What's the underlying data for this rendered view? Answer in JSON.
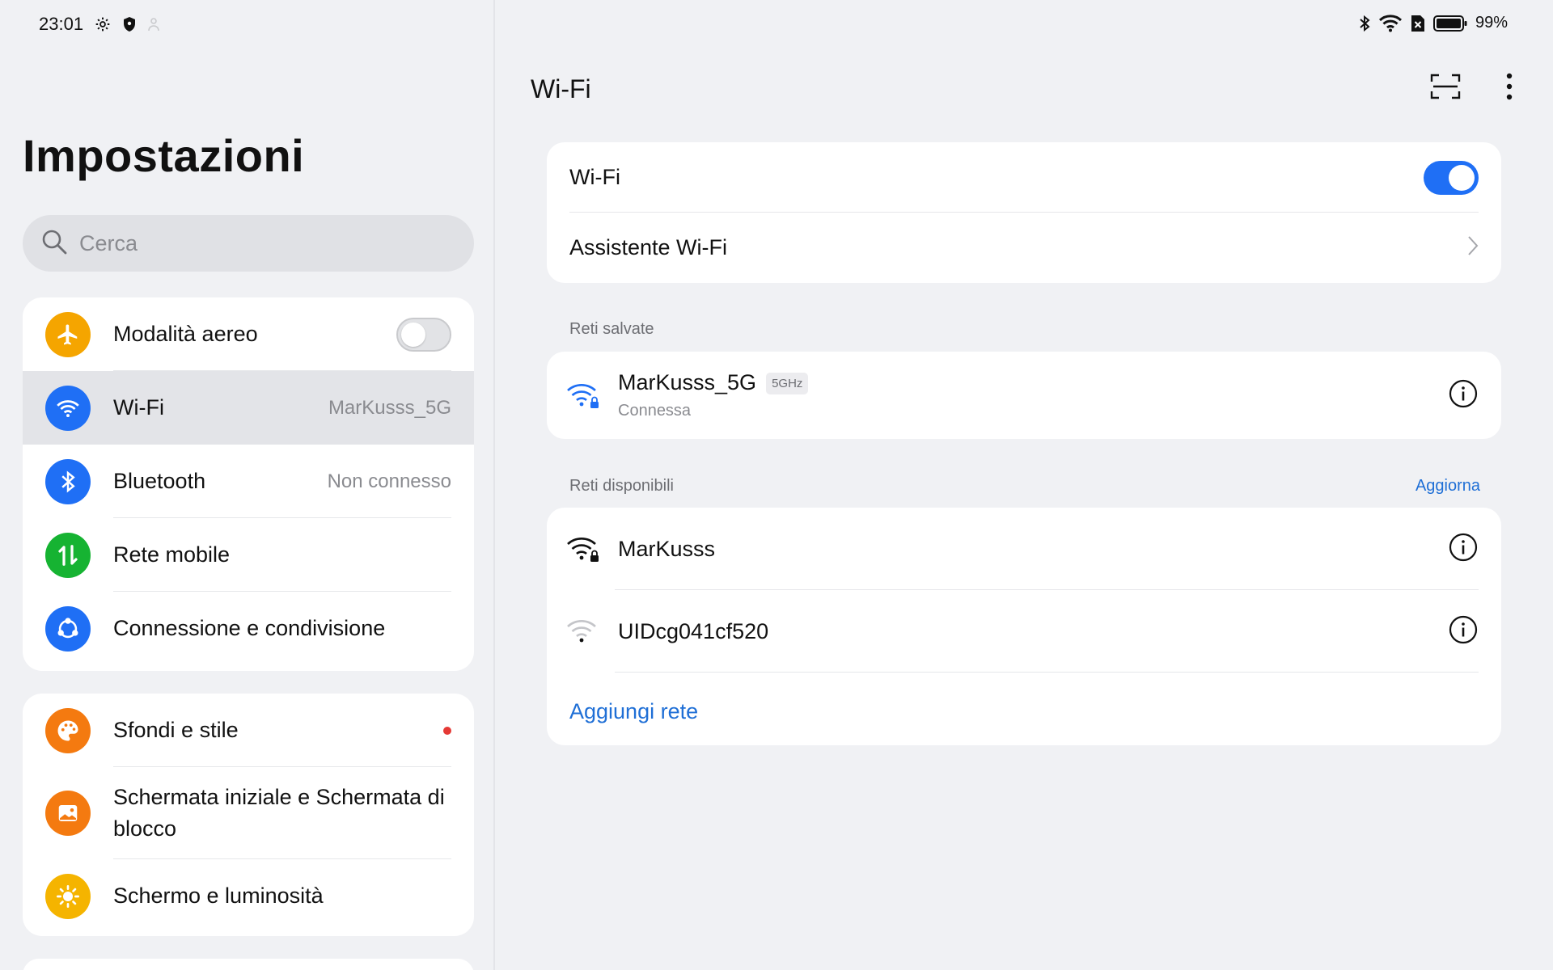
{
  "status_bar": {
    "time": "23:01",
    "battery": "99%",
    "left_icons": [
      "gear-icon",
      "shield-icon",
      "person-icon"
    ],
    "right_icons": [
      "bluetooth-icon",
      "wifi-icon",
      "sim-off-icon",
      "battery-icon"
    ]
  },
  "sidebar": {
    "title": "Impostazioni",
    "search_placeholder": "Cerca",
    "group1": [
      {
        "label": "Modalità aereo",
        "icon": "airplane-icon",
        "color": "#f5a500"
      },
      {
        "label": "Wi-Fi",
        "value": "MarKusss_5G",
        "icon": "wifi-icon",
        "color": "#1f6ff5"
      },
      {
        "label": "Bluetooth",
        "value": "Non connesso",
        "icon": "bluetooth-icon",
        "color": "#1f6ff5"
      },
      {
        "label": "Rete mobile",
        "icon": "mobile-data-icon",
        "color": "#16b332"
      },
      {
        "label": "Connessione e condivisione",
        "icon": "share-icon",
        "color": "#1f6ff5"
      }
    ],
    "group2": [
      {
        "label": "Sfondi e stile",
        "icon": "palette-icon",
        "color": "#f47a10"
      },
      {
        "label": "Schermata iniziale e Schermata di blocco",
        "icon": "wallpaper-icon",
        "color": "#f47a10"
      },
      {
        "label": "Schermo e luminosità",
        "icon": "sun-icon",
        "color": "#f5b400"
      }
    ]
  },
  "detail": {
    "title": "Wi-Fi",
    "wifi_toggle_label": "Wi-Fi",
    "assistant_label": "Assistente Wi-Fi",
    "saved_section": "Reti salvate",
    "saved_network": {
      "name": "MarKusss_5G",
      "band": "5GHz",
      "status": "Connessa"
    },
    "available_section": "Reti disponibili",
    "refresh_label": "Aggiorna",
    "available_networks": [
      {
        "name": "MarKusss"
      },
      {
        "name": "UIDcg041cf520"
      }
    ],
    "add_network_label": "Aggiungi rete",
    "accent_color": "#1f6ff5"
  }
}
